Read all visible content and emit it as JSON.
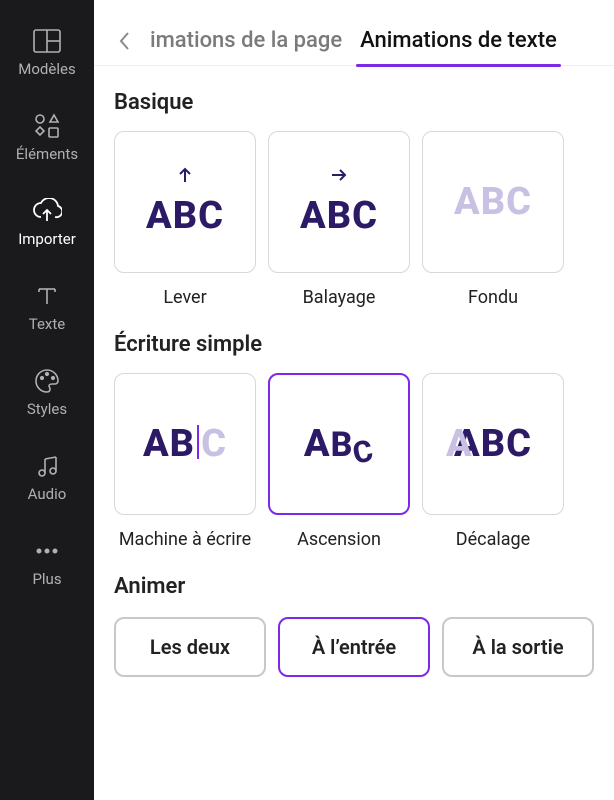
{
  "sidebar": {
    "items": [
      {
        "label": "Modèles"
      },
      {
        "label": "Éléments"
      },
      {
        "label": "Importer"
      },
      {
        "label": "Texte"
      },
      {
        "label": "Styles"
      },
      {
        "label": "Audio"
      },
      {
        "label": "Plus"
      }
    ]
  },
  "tabs": {
    "page": "imations de la page",
    "text": "Animations de texte"
  },
  "sections": {
    "basic": {
      "title": "Basique",
      "items": [
        {
          "label": "Lever"
        },
        {
          "label": "Balayage"
        },
        {
          "label": "Fondu"
        }
      ]
    },
    "writing": {
      "title": "Écriture simple",
      "items": [
        {
          "label": "Machine à écrire"
        },
        {
          "label": "Ascension"
        },
        {
          "label": "Décalage"
        }
      ]
    }
  },
  "animate": {
    "title": "Animer",
    "buttons": {
      "both": "Les deux",
      "in": "À l’entrée",
      "out": "À la sortie"
    }
  },
  "glyphs": {
    "abc": "ABC",
    "ab": "AB",
    "c": "C",
    "a": "A",
    "b": "B",
    "bc": "BC"
  },
  "colors": {
    "accent": "#7d2ae8",
    "text_dark": "#2c1a66"
  }
}
